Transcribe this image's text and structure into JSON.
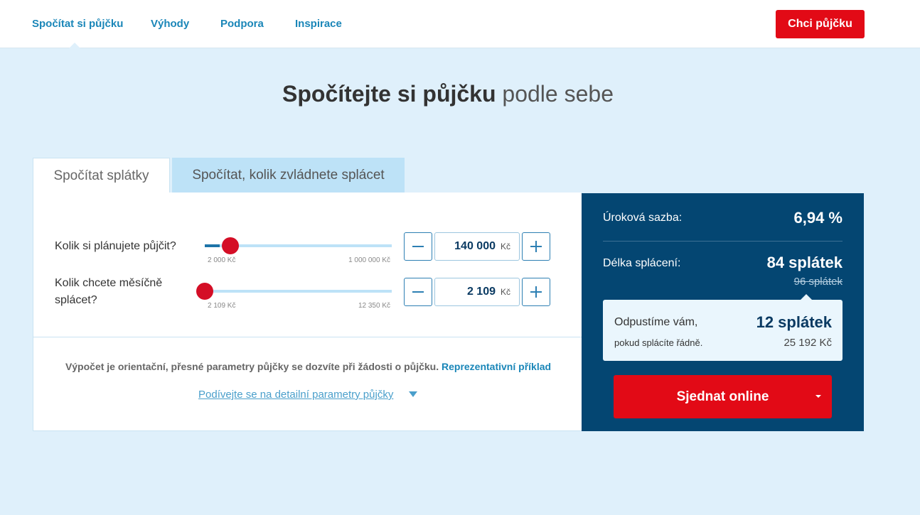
{
  "nav": {
    "items": [
      {
        "label": "Spočítat si půjčku"
      },
      {
        "label": "Výhody"
      },
      {
        "label": "Podpora"
      },
      {
        "label": "Inspirace"
      }
    ],
    "active_index": 0,
    "cta_label": "Chci půjčku"
  },
  "headline": {
    "strong": "Spočítejte si půjčku",
    "light": "podle sebe"
  },
  "tabs": [
    {
      "label": "Spočítat splátky",
      "active": true
    },
    {
      "label": "Spočítat, kolik zvládnete splácet",
      "active": false
    }
  ],
  "calculator": {
    "loan": {
      "label": "Kolik si plánujete půjčit?",
      "value": "140 000",
      "unit": "Kč",
      "min_label": "2 000 Kč",
      "max_label": "1 000 000 Kč",
      "min": 2000,
      "max": 1000000,
      "current": 140000
    },
    "payment": {
      "label_line1": "Kolik chcete měsíčně",
      "label_line2": "splácet?",
      "value": "2 109",
      "unit": "Kč",
      "min_label": "2 109 Kč",
      "max_label": "12 350 Kč",
      "min": 2109,
      "max": 12350,
      "current": 2109
    },
    "note_text": "Výpočet je orientační, přesné parametry půjčky se dozvíte při žádosti o půjčku.",
    "note_link": "Reprezentativní příklad",
    "details_link": "Podívejte se na detailní parametry půjčky"
  },
  "summary": {
    "rate_label": "Úroková sazba:",
    "rate_value": "6,94 %",
    "term_label": "Délka splácení:",
    "term_value": "84 splátek",
    "term_old": "96 splátek",
    "forgive_title": "Odpustíme vám,",
    "forgive_sub": "pokud splácíte řádně.",
    "forgive_value": "12 splátek",
    "forgive_amount": "25 192 Kč",
    "cta_label": "Sjednat online"
  },
  "colors": {
    "brand_red": "#e20a16",
    "navy": "#044672",
    "link_blue": "#1a86b8",
    "page_bg": "#dff0fb"
  }
}
